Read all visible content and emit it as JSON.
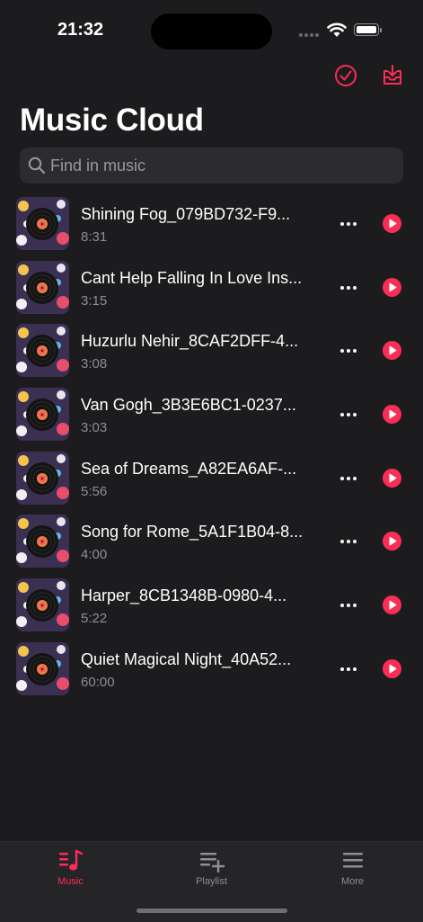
{
  "status_bar": {
    "time": "21:32"
  },
  "header": {
    "title": "Music Cloud",
    "actions": [
      {
        "name": "select-all",
        "icon": "checkmark-circle-icon"
      },
      {
        "name": "download",
        "icon": "tray-download-icon"
      }
    ]
  },
  "search": {
    "placeholder": "Find in music",
    "value": ""
  },
  "colors": {
    "accent": "#fa2d55",
    "background": "#1c1c1e",
    "search_bg": "#2c2c2e",
    "secondary_text": "#8e8e93"
  },
  "tracks": [
    {
      "title": "Shining Fog_079BD732-F9...",
      "duration": "8:31"
    },
    {
      "title": "Cant Help Falling In Love Ins...",
      "duration": "3:15"
    },
    {
      "title": "Huzurlu Nehir_8CAF2DFF-4...",
      "duration": "3:08"
    },
    {
      "title": "Van Gogh_3B3E6BC1-0237...",
      "duration": "3:03"
    },
    {
      "title": "Sea of Dreams_A82EA6AF-...",
      "duration": "5:56"
    },
    {
      "title": "Song for Rome_5A1F1B04-8...",
      "duration": "4:00"
    },
    {
      "title": "Harper_8CB1348B-0980-4...",
      "duration": "5:22"
    },
    {
      "title": "Quiet Magical Night_40A52...",
      "duration": "60:00"
    }
  ],
  "tab_bar": {
    "tabs": [
      {
        "label": "Music",
        "icon": "music-list-icon",
        "active": true
      },
      {
        "label": "Playlist",
        "icon": "playlist-add-icon",
        "active": false
      },
      {
        "label": "More",
        "icon": "hamburger-menu-icon",
        "active": false
      }
    ]
  }
}
